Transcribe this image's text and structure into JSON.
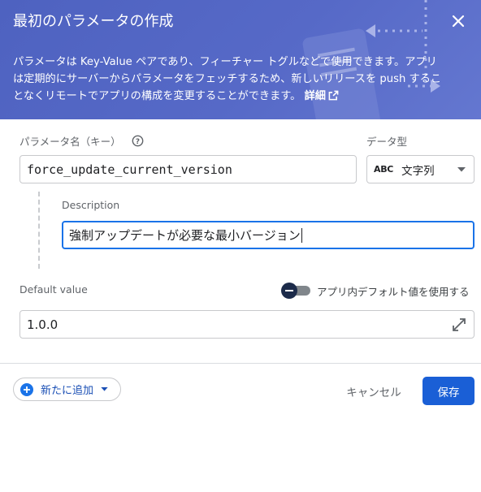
{
  "dialog": {
    "title": "最初のパラメータの作成",
    "description": "パラメータは Key-Value ペアであり、フィーチャー トグルなどで使用できます。アプリは定期的にサーバーからパラメータをフェッチするため、新しいリリースを push することなくリモートでアプリの構成を変更することができます。",
    "details_link": "詳細"
  },
  "form": {
    "param_name_label": "パラメータ名（キー）",
    "param_name_value": "force_update_current_version",
    "data_type_label": "データ型",
    "data_type_icon_text": "ABC",
    "data_type_value": "文字列",
    "description_label": "Description",
    "description_value": "強制アップデートが必要な最小バージョン",
    "default_value_label": "Default value",
    "use_in_app_default_label": "アプリ内デフォルト値を使用する",
    "use_in_app_default_on": false,
    "default_value": "1.0.0"
  },
  "footer": {
    "add_new_label": "新たに追加",
    "cancel_label": "キャンセル",
    "save_label": "保存"
  },
  "colors": {
    "header_bg": "#5669c7",
    "primary": "#1a5fd6",
    "focus": "#1a73e8"
  },
  "icons": [
    "close-icon",
    "help-icon",
    "external-link-icon",
    "chevron-down-icon",
    "expand-icon",
    "plus-circle-icon"
  ]
}
